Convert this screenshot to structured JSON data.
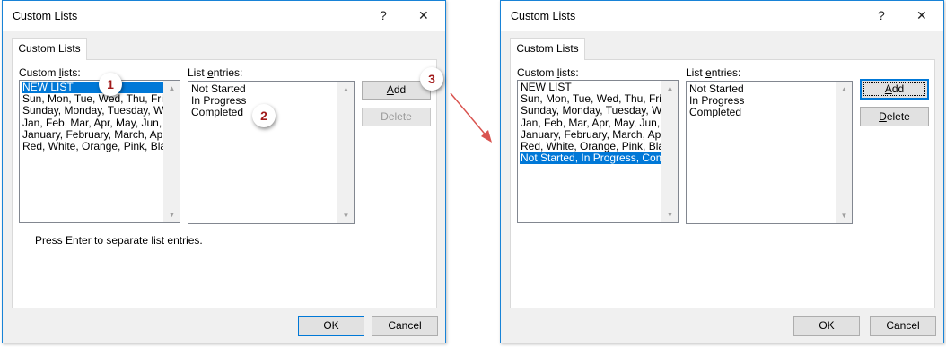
{
  "before_dialog": {
    "title": "Custom Lists",
    "help_glyph": "?",
    "close_glyph": "✕",
    "tab_label": "Custom Lists",
    "custom_lists_label": "Custom lists:",
    "list_entries_label": "List entries:",
    "custom_lists": [
      {
        "text": "NEW LIST",
        "selected": true
      },
      {
        "text": "Sun, Mon, Tue, Wed, Thu, Fri, S",
        "selected": false
      },
      {
        "text": "Sunday, Monday, Tuesday, We",
        "selected": false
      },
      {
        "text": "Jan, Feb, Mar, Apr, May, Jun, Ju",
        "selected": false
      },
      {
        "text": "January, February, March, Apri",
        "selected": false
      },
      {
        "text": "Red, White, Orange, Pink, Blac",
        "selected": false
      }
    ],
    "list_entries": [
      "Not Started",
      "In Progress",
      "Completed"
    ],
    "add_label": "Add",
    "delete_label": "Delete",
    "hint": "Press Enter to separate list entries.",
    "ok_label": "OK",
    "cancel_label": "Cancel",
    "badges": [
      "1",
      "2",
      "3"
    ]
  },
  "after_dialog": {
    "title": "Custom Lists",
    "help_glyph": "?",
    "close_glyph": "✕",
    "tab_label": "Custom Lists",
    "custom_lists_label": "Custom lists:",
    "list_entries_label": "List entries:",
    "custom_lists": [
      {
        "text": "NEW LIST",
        "selected": false
      },
      {
        "text": "Sun, Mon, Tue, Wed, Thu, Fri, S",
        "selected": false
      },
      {
        "text": "Sunday, Monday, Tuesday, We",
        "selected": false
      },
      {
        "text": "Jan, Feb, Mar, Apr, May, Jun, Ju",
        "selected": false
      },
      {
        "text": "January, February, March, Apri",
        "selected": false
      },
      {
        "text": "Red, White, Orange, Pink, Blac",
        "selected": false
      },
      {
        "text": "Not Started, In Progress, Comp",
        "selected": true
      }
    ],
    "list_entries": [
      "Not Started",
      "In Progress",
      "Completed"
    ],
    "add_label": "Add",
    "delete_label": "Delete",
    "ok_label": "OK",
    "cancel_label": "Cancel"
  },
  "colors": {
    "accent": "#0078d7",
    "badge_text": "#a11a1a",
    "arrow": "#d9534f"
  }
}
